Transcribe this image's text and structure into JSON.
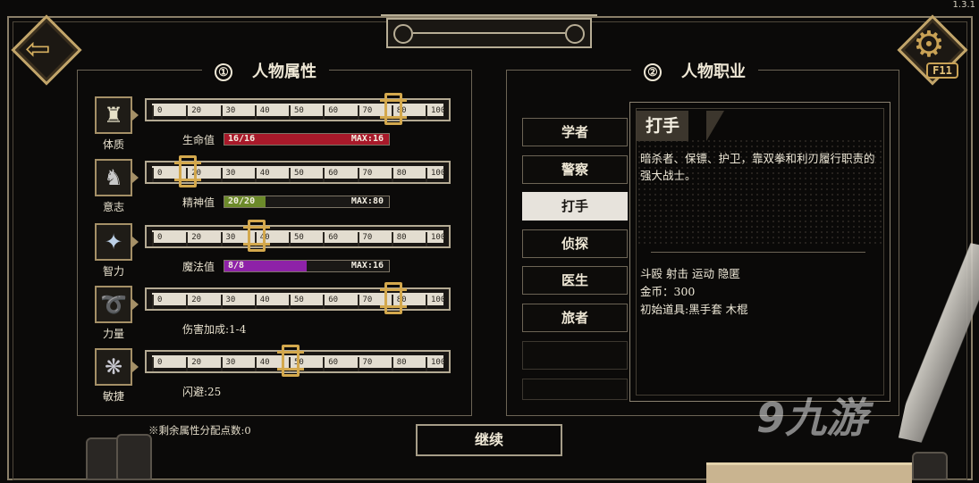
{
  "version": "1.3.1",
  "hotkey": "F11",
  "attributes_panel": {
    "number": "①",
    "title": "人物属性",
    "scale_ticks": [
      "0",
      "20",
      "30",
      "40",
      "50",
      "60",
      "70",
      "80",
      "100"
    ],
    "rows": [
      {
        "label": "体质",
        "icon": "torso-icon",
        "value": 80,
        "stat_label": "生命值",
        "stat_value": "16/16",
        "stat_max": "MAX:16",
        "fill": 1.0,
        "color": "#a8192a"
      },
      {
        "label": "意志",
        "icon": "helmet-icon",
        "value": 20,
        "stat_label": "精神值",
        "stat_value": "20/20",
        "stat_max": "MAX:80",
        "fill": 0.25,
        "color": "#6c8a2a"
      },
      {
        "label": "智力",
        "icon": "brain-icon",
        "value": 40,
        "stat_label": "魔法值",
        "stat_value": "8/8",
        "stat_max": "MAX:16",
        "fill": 0.5,
        "color": "#8e22a8"
      },
      {
        "label": "力量",
        "icon": "arm-icon",
        "value": 80,
        "stat_text": "伤害加成:1-4"
      },
      {
        "label": "敏捷",
        "icon": "wind-icon",
        "value": 50,
        "stat_text": "闪避:25"
      }
    ],
    "remaining": "※剩余属性分配点数:0"
  },
  "jobs_panel": {
    "number": "②",
    "title": "人物职业",
    "jobs": [
      "学者",
      "警察",
      "打手",
      "侦探",
      "医生",
      "旅者"
    ],
    "selected": "打手",
    "detail": {
      "title": "打手",
      "description": "暗杀者、保镖、护卫，靠双拳和利刃履行职责的强大战士。",
      "skills": "斗殴 射击 运动 隐匿",
      "gold": "金币：300",
      "items": "初始道具:黑手套 木棍"
    }
  },
  "continue_label": "继续",
  "watermark": "9九游"
}
